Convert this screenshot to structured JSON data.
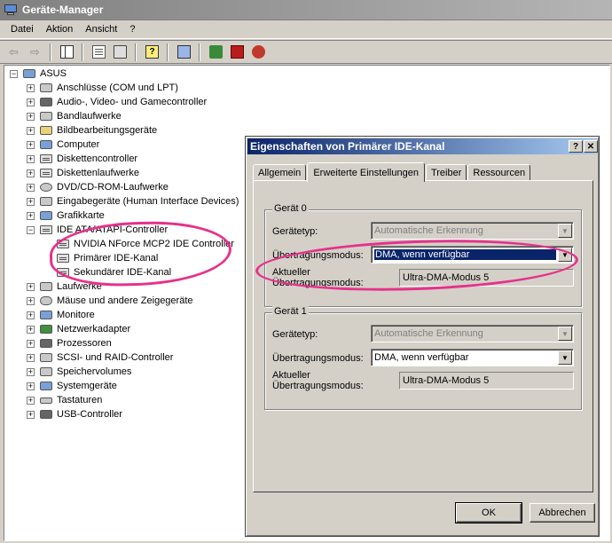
{
  "window": {
    "title": "Geräte-Manager"
  },
  "menu": [
    "Datei",
    "Aktion",
    "Ansicht",
    "?"
  ],
  "toolbar_icons": [
    "back-arrow-icon",
    "forward-arrow-icon",
    "show-hide-console-tree-icon",
    "properties-icon",
    "print-icon",
    "help-icon",
    "scan-hardware-icon",
    "update-driver-icon",
    "uninstall-icon",
    "disable-icon"
  ],
  "tree": {
    "root": "ASUS",
    "items": [
      "Anschlüsse (COM und LPT)",
      "Audio-, Video- und Gamecontroller",
      "Bandlaufwerke",
      "Bildbearbeitungsgeräte",
      "Computer",
      "Diskettencontroller",
      "Diskettenlaufwerke",
      "DVD/CD-ROM-Laufwerke",
      "Eingabegeräte (Human Interface Devices)",
      "Grafikkarte",
      "IDE ATA/ATAPI-Controller"
    ],
    "ide_children": [
      "NVIDIA NForce MCP2 IDE Controller",
      "Primärer IDE-Kanal",
      "Sekundärer IDE-Kanal"
    ],
    "items_after": [
      "Laufwerke",
      "Mäuse und andere Zeigegeräte",
      "Monitore",
      "Netzwerkadapter",
      "Prozessoren",
      "SCSI- und RAID-Controller",
      "Speichervolumes",
      "Systemgeräte",
      "Tastaturen",
      "USB-Controller"
    ]
  },
  "dialog": {
    "title": "Eigenschaften von Primärer IDE-Kanal",
    "help_btn": "?",
    "close_btn": "✕",
    "tabs": [
      "Allgemein",
      "Erweiterte Einstellungen",
      "Treiber",
      "Ressourcen"
    ],
    "active_tab": "Erweiterte Einstellungen",
    "device0": {
      "legend": "Gerät 0",
      "type_label": "Gerätetyp:",
      "type_value": "Automatische Erkennung",
      "mode_label": "Übertragungsmodus:",
      "mode_value": "DMA, wenn verfügbar",
      "current_label_1": "Aktueller",
      "current_label_2": "Übertragungsmodus:",
      "current_value": "Ultra-DMA-Modus 5"
    },
    "device1": {
      "legend": "Gerät 1",
      "type_label": "Gerätetyp:",
      "type_value": "Automatische Erkennung",
      "mode_label": "Übertragungsmodus:",
      "mode_value": "DMA, wenn verfügbar",
      "current_label_1": "Aktueller",
      "current_label_2": "Übertragungsmodus:",
      "current_value": "Ultra-DMA-Modus 5"
    },
    "ok": "OK",
    "cancel": "Abbrechen"
  },
  "colors": {
    "title_active": "#0a246a",
    "title_inactive": "#808080",
    "annotation": "#e6318c"
  }
}
